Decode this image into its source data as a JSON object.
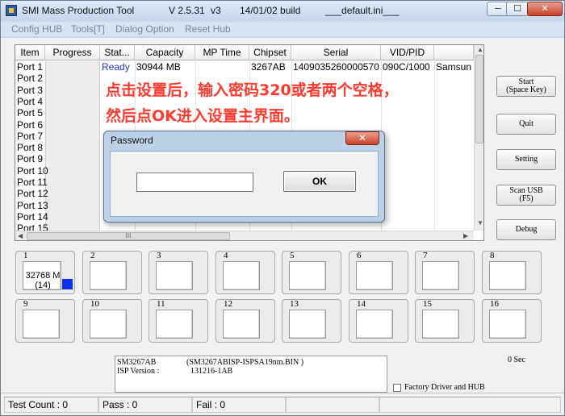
{
  "window": {
    "title": "SMI Mass Production Tool",
    "version": "V 2.5.31",
    "build_tag": "v3",
    "build_date": "14/01/02 build",
    "ini_file": "___default.ini___",
    "min_label": "─",
    "max_label": "☐",
    "close_label": "✕"
  },
  "menu": [
    "Config HUB",
    "Tools[T]",
    "Dialog Option",
    "Reset Hub"
  ],
  "grid": {
    "columns": [
      "Item",
      "Progress",
      "Stat...",
      "Capacity",
      "MP Time",
      "Chipset",
      "Serial",
      "VID/PID",
      ""
    ],
    "ports": [
      "Port 1",
      "Port 2",
      "Port 3",
      "Port 4",
      "Port 5",
      "Port 6",
      "Port 7",
      "Port 8",
      "Port 9",
      "Port 10",
      "Port 11",
      "Port 12",
      "Port 13",
      "Port 14",
      "Port 15"
    ],
    "row1": {
      "status": "Ready",
      "capacity": "30944 MB",
      "chipset": "3267AB",
      "serial": "1409035260000570",
      "vidpid": "090C/1000",
      "vendor": "Samsun"
    },
    "hscroll_grip": "III"
  },
  "annotation": {
    "line1": "点击设置后，输入密码320或者两个空格，",
    "line2": "然后点OK进入设置主界面。"
  },
  "side_buttons": {
    "start": "Start",
    "start_key": "(Space Key)",
    "quit": "Quit",
    "setting": "Setting",
    "scan": "Scan USB",
    "scan_key": "(F5)",
    "debug": "Debug"
  },
  "slots": [
    "1",
    "2",
    "3",
    "4",
    "5",
    "6",
    "7",
    "8",
    "9",
    "10",
    "11",
    "12",
    "13",
    "14",
    "15",
    "16"
  ],
  "slot1": {
    "capacity": "32768 M",
    "count": "(14)"
  },
  "info": {
    "chip": "SM3267AB",
    "bin": "(SM3267ABISP-ISPSA19nm.BIN )",
    "isp_label": "ISP Version :",
    "isp_value": "131216-1AB"
  },
  "timer": "0 Sec",
  "factory_option": "Factory Driver and HUB",
  "status": {
    "test_count": "Test Count : 0",
    "pass": "Pass : 0",
    "fail": "Fail : 0"
  },
  "dialog": {
    "title": "Password",
    "close_label": "✕",
    "password_value": "",
    "ok_label": "OK"
  }
}
